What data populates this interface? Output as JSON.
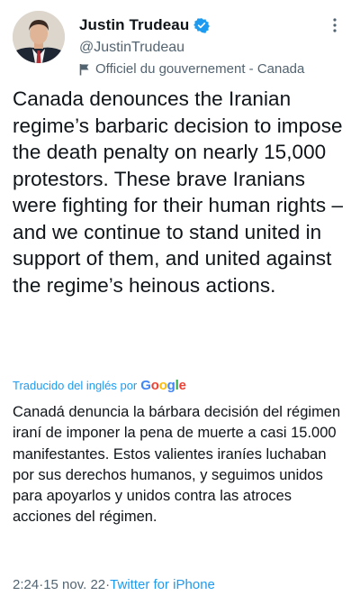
{
  "author": {
    "display_name": "Justin Trudeau",
    "handle": "@JustinTrudeau",
    "label": "Officiel du gouvernement - Canada",
    "avatar_icon": "profile-photo",
    "verified_color": "#1d9bf0"
  },
  "tweet": {
    "text": "Canada denounces the Iranian regime’s barbaric decision to impose the death penalty on nearly 15,000 protestors. These brave Iranians were fighting for their human rights – and we continue to stand united in support of them, and united against the regime’s heinous actions."
  },
  "translation": {
    "label": "Traducido del inglés por",
    "provider_letters": [
      "G",
      "o",
      "o",
      "g",
      "l",
      "e"
    ],
    "text": "Canadá denuncia la bárbara decisión del régimen iraní de imponer la pena de muerte a casi 15.000 manifestantes. Estos valientes iraníes luchaban por sus derechos humanos, y seguimos unidos para apoyarlos y unidos contra las atroces acciones del régimen."
  },
  "meta": {
    "time": "2:24",
    "separator": " · ",
    "date": "15 nov. 22",
    "source": "Twitter for iPhone"
  },
  "colors": {
    "link": "#1d9bf0",
    "secondary_text": "#536471",
    "primary_text": "#0f1419"
  }
}
